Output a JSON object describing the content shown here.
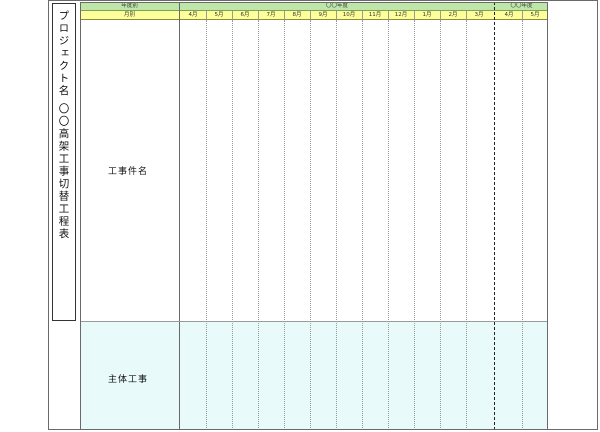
{
  "document": {
    "vertical_title": "プロジェクト名 〇〇高架工事切替工程表",
    "header": {
      "year_caption": "年度別",
      "month_caption": "月別",
      "fiscal_year_1": "〇〇年度",
      "fiscal_year_2": "〇〇年度"
    },
    "months": [
      "4月",
      "5月",
      "6月",
      "7月",
      "8月",
      "9月",
      "10月",
      "11月",
      "12月",
      "1月",
      "2月",
      "3月",
      "4月",
      "5月"
    ],
    "rows": [
      {
        "label": "工事件名"
      },
      {
        "label": "主体工事"
      }
    ],
    "colors": {
      "year_header_bg": "#bfe6a9",
      "month_header_bg": "#ffff9a",
      "lower_section_bg": "#e8fafa"
    }
  }
}
